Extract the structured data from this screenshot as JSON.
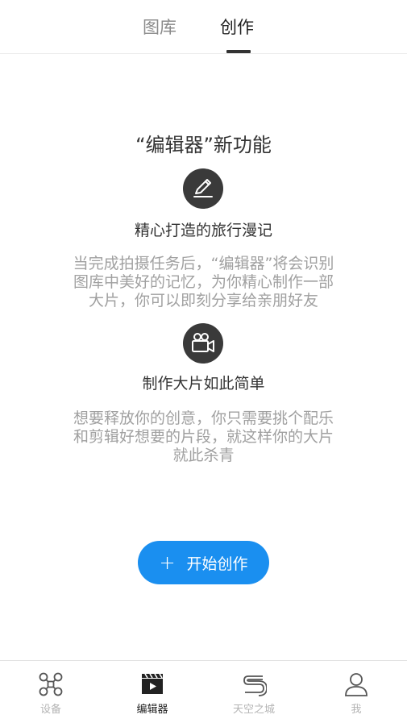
{
  "tabs": {
    "gallery": "图库",
    "create": "创作"
  },
  "main": {
    "headline": "“编辑器”新功能",
    "feature1": {
      "icon": "pencil-icon",
      "title": "精心打造的旅行漫记",
      "desc_line1": "当完成拍摄任务后，“编辑器”将会识别",
      "desc_line2": "图库中美好的记忆，为你精心制作一部",
      "desc_line3": "大片，你可以即刻分享给亲朋好友"
    },
    "feature2": {
      "icon": "video-camera-icon",
      "title": "制作大片如此简单",
      "desc_line1": "想要释放你的创意，你只需要挑个配乐",
      "desc_line2": "和剪辑好想要的片段，就这样你的大片",
      "desc_line3": "就此杀青"
    },
    "start_button": {
      "plus": "+",
      "label": "开始创作"
    }
  },
  "bottom_nav": {
    "items": [
      {
        "label": "设备",
        "icon": "drone-icon",
        "active": false
      },
      {
        "label": "编辑器",
        "icon": "clapperboard-icon",
        "active": true
      },
      {
        "label": "天空之城",
        "icon": "skypixel-icon",
        "active": false
      },
      {
        "label": "我",
        "icon": "user-icon",
        "active": false
      }
    ]
  },
  "colors": {
    "accent": "#1a8ff0",
    "icon_bg": "#3a3a3a",
    "muted_text": "#a0a0a0"
  }
}
